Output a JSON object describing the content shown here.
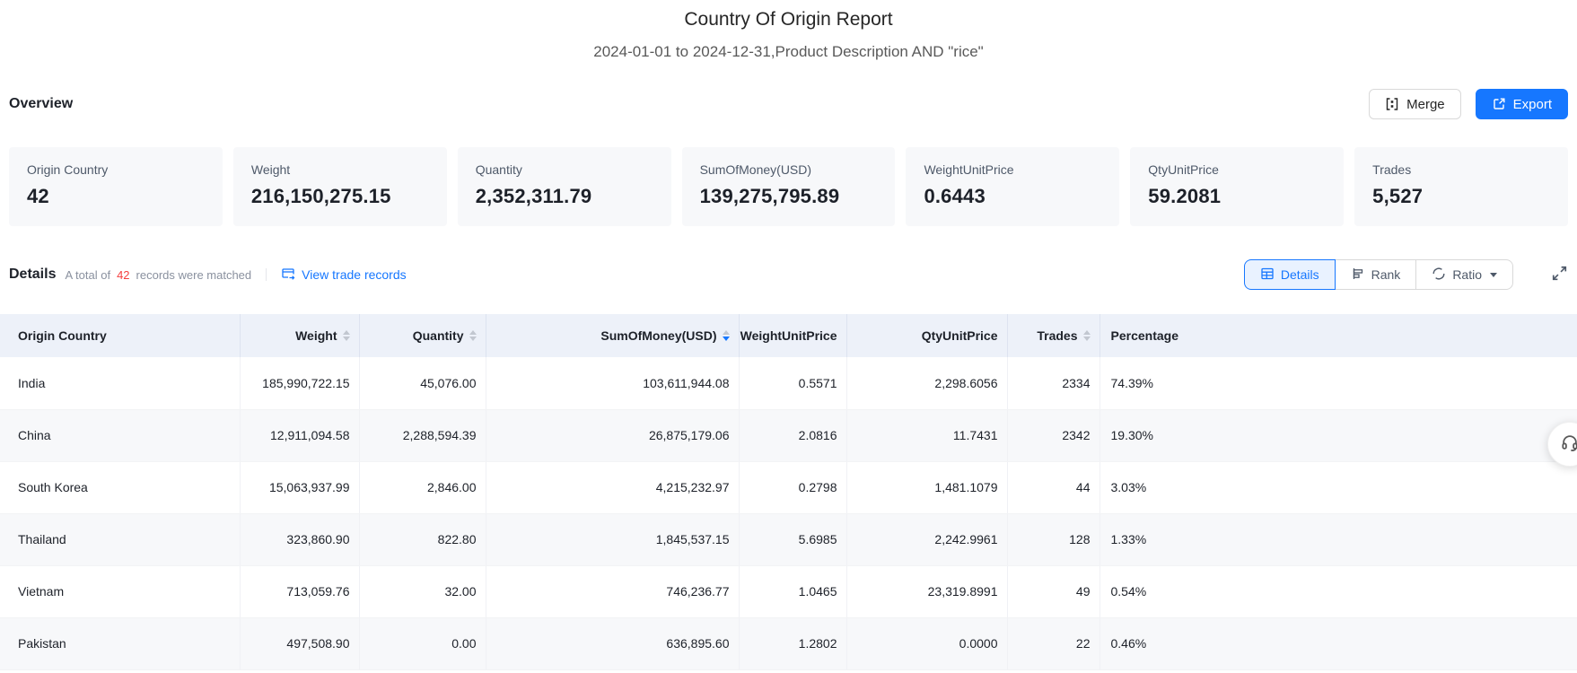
{
  "report": {
    "title": "Country Of Origin Report",
    "subtitle": "2024-01-01 to 2024-12-31,Product Description AND \"rice\""
  },
  "overview": {
    "heading": "Overview",
    "merge_label": "Merge",
    "export_label": "Export",
    "cards": [
      {
        "label": "Origin Country",
        "value": "42"
      },
      {
        "label": "Weight",
        "value": "216,150,275.15"
      },
      {
        "label": "Quantity",
        "value": "2,352,311.79"
      },
      {
        "label": "SumOfMoney(USD)",
        "value": "139,275,795.89"
      },
      {
        "label": "WeightUnitPrice",
        "value": "0.6443"
      },
      {
        "label": "QtyUnitPrice",
        "value": "59.2081"
      },
      {
        "label": "Trades",
        "value": "5,527"
      }
    ]
  },
  "details": {
    "heading": "Details",
    "total_prefix": "A total of",
    "total_count": "42",
    "total_suffix": "records were matched",
    "view_link": "View trade records",
    "tabs": [
      {
        "label": "Details",
        "active": true
      },
      {
        "label": "Rank",
        "active": false
      },
      {
        "label": "Ratio",
        "active": false,
        "dropdown": true
      }
    ]
  },
  "table": {
    "columns": [
      {
        "label": "Origin Country",
        "sortable": false,
        "align": "left"
      },
      {
        "label": "Weight",
        "sortable": true,
        "align": "right"
      },
      {
        "label": "Quantity",
        "sortable": true,
        "align": "right"
      },
      {
        "label": "SumOfMoney(USD)",
        "sortable": true,
        "align": "right",
        "sort": "desc"
      },
      {
        "label": "WeightUnitPrice",
        "sortable": false,
        "align": "right"
      },
      {
        "label": "QtyUnitPrice",
        "sortable": false,
        "align": "right"
      },
      {
        "label": "Trades",
        "sortable": true,
        "align": "right"
      },
      {
        "label": "Percentage",
        "sortable": false,
        "align": "left"
      }
    ],
    "rows": [
      [
        "India",
        "185,990,722.15",
        "45,076.00",
        "103,611,944.08",
        "0.5571",
        "2,298.6056",
        "2334",
        "74.39%"
      ],
      [
        "China",
        "12,911,094.58",
        "2,288,594.39",
        "26,875,179.06",
        "2.0816",
        "11.7431",
        "2342",
        "19.30%"
      ],
      [
        "South Korea",
        "15,063,937.99",
        "2,846.00",
        "4,215,232.97",
        "0.2798",
        "1,481.1079",
        "44",
        "3.03%"
      ],
      [
        "Thailand",
        "323,860.90",
        "822.80",
        "1,845,537.15",
        "5.6985",
        "2,242.9961",
        "128",
        "1.33%"
      ],
      [
        "Vietnam",
        "713,059.76",
        "32.00",
        "746,236.77",
        "1.0465",
        "23,319.8991",
        "49",
        "0.54%"
      ],
      [
        "Pakistan",
        "497,508.90",
        "0.00",
        "636,895.60",
        "1.2802",
        "0.0000",
        "22",
        "0.46%"
      ]
    ]
  },
  "icons": {
    "merge": "merge-cells",
    "export": "box-with-out-arrow",
    "view_trade": "trade-card-arrow",
    "tab_details": "table-grid",
    "tab_rank": "horizontal-bars",
    "tab_ratio": "sync-circle",
    "fullscreen": "expand-arrows",
    "support": "headset",
    "sort": "caret-up-down"
  },
  "colors": {
    "accent": "#1677ff",
    "count_red": "#f53f3f",
    "table_header_bg": "#edf1f9",
    "card_bg": "#f7f8fa",
    "stripe_bg": "#f7f8fa",
    "active_tab_bg": "#e9f2ff"
  }
}
